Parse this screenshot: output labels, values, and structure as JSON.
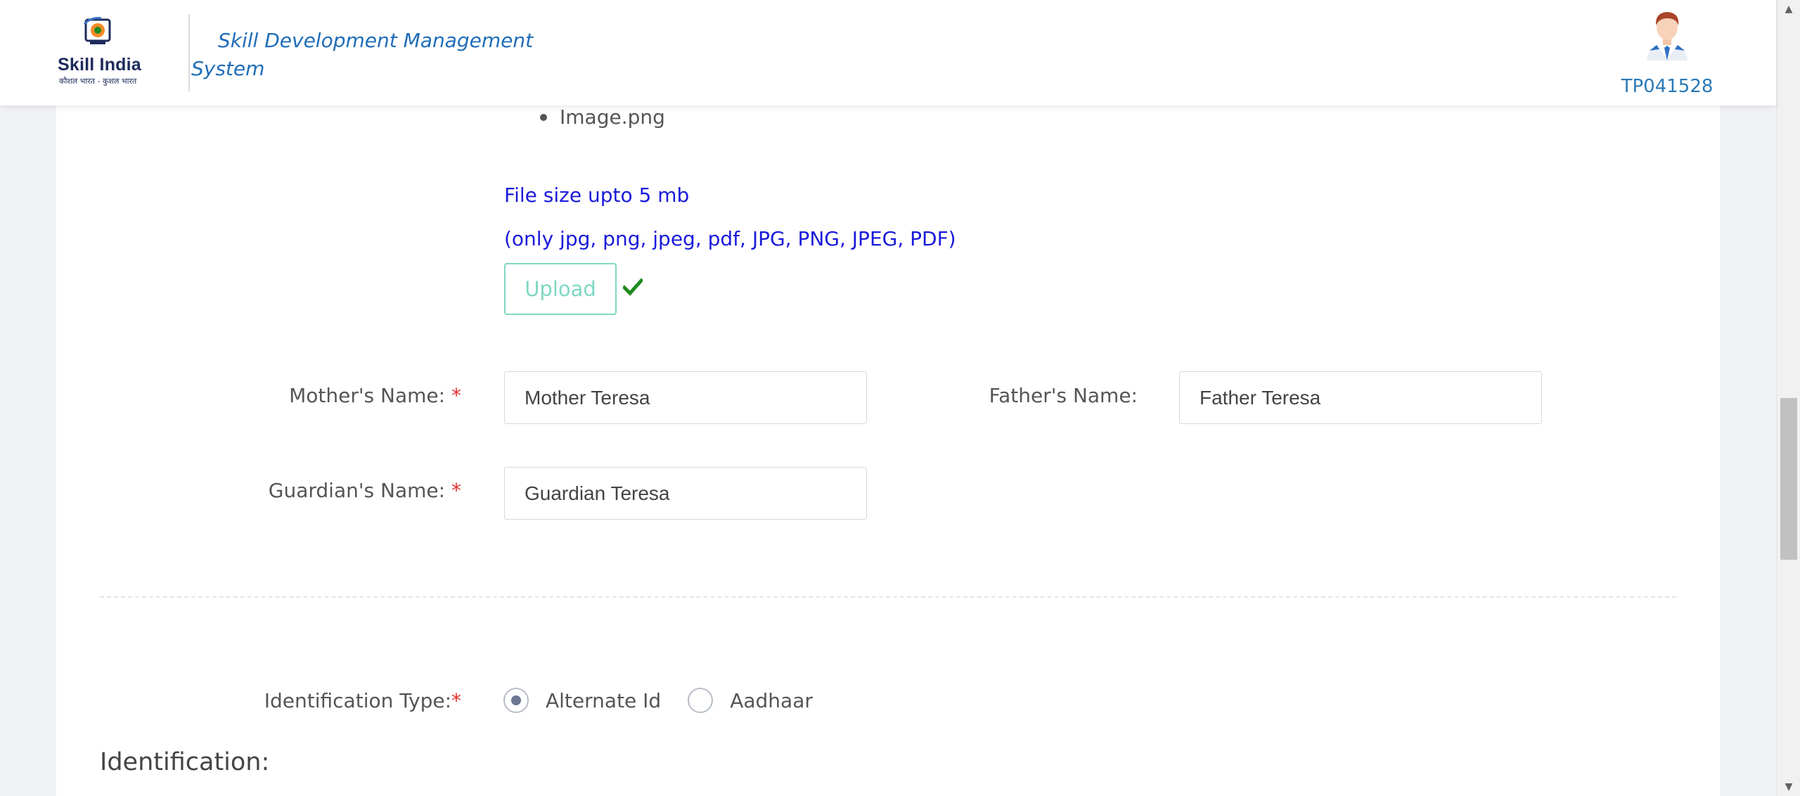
{
  "header": {
    "logo_text": "Skill India",
    "logo_tagline": "कौशल भारत - कुशल भारत",
    "app_title": "Skill Development Management System",
    "user_id": "TP041528"
  },
  "upload": {
    "file_name": "Image.png",
    "size_note": "File size upto 5 mb",
    "types_note": "(only jpg, png, jpeg, pdf, JPG, PNG, JPEG, PDF)",
    "button_label": "Upload",
    "status_icon": "check-icon"
  },
  "form": {
    "mother_label": "Mother's Name:",
    "mother_value": "Mother Teresa",
    "father_label": "Father's Name:",
    "father_value": "Father Teresa",
    "guardian_label": "Guardian's Name:",
    "guardian_value": "Guardian Teresa",
    "required_mark": "*"
  },
  "identification": {
    "type_label": "Identification Type:",
    "options": [
      "Alternate Id",
      "Aadhaar"
    ],
    "selected": "Alternate Id",
    "section_heading": "Identification:"
  },
  "colors": {
    "brand_blue": "#1f6db8",
    "note_blue": "#1a1adb",
    "upload_teal": "#7fd8c2",
    "success_green": "#1e8a1e",
    "required_red": "#e0312e"
  }
}
